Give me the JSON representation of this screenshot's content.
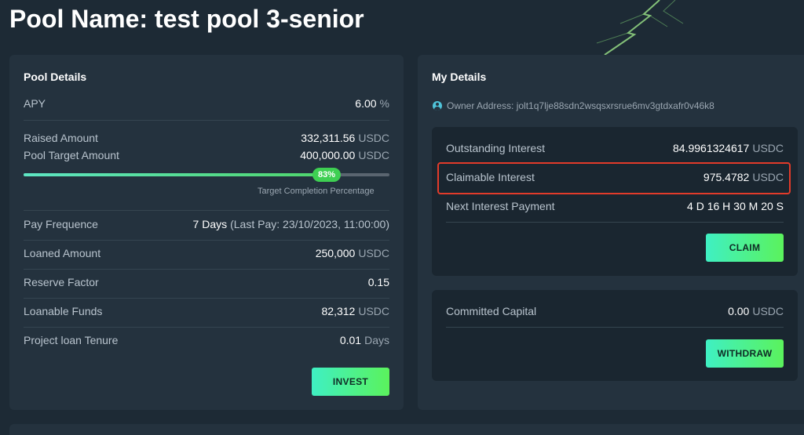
{
  "page": {
    "title": "Pool Name: test pool 3-senior"
  },
  "pool_details": {
    "title": "Pool Details",
    "apy": {
      "label": "APY",
      "value": "6.00",
      "unit": "%"
    },
    "raised": {
      "label": "Raised Amount",
      "value": "332,311.56",
      "unit": "USDC"
    },
    "target": {
      "label": "Pool Target Amount",
      "value": "400,000.00",
      "unit": "USDC"
    },
    "progress": {
      "percent": 83,
      "badge": "83%",
      "caption": "Target Completion Percentage"
    },
    "pay_frequence": {
      "label": "Pay Frequence",
      "value": "7 Days",
      "extra": "(Last Pay: 23/10/2023, 11:00:00)"
    },
    "loaned": {
      "label": "Loaned Amount",
      "value": "250,000",
      "unit": "USDC"
    },
    "reserve": {
      "label": "Reserve Factor",
      "value": "0.15"
    },
    "loanable": {
      "label": "Loanable Funds",
      "value": "82,312",
      "unit": "USDC"
    },
    "tenure": {
      "label": "Project loan Tenure",
      "value": "0.01",
      "unit": "Days"
    },
    "invest_label": "INVEST"
  },
  "my_details": {
    "title": "My Details",
    "owner_address": "Owner Address: jolt1q7lje88sdn2wsqsxrsrue6mv3gtdxafr0v46k8",
    "outstanding": {
      "label": "Outstanding Interest",
      "value": "84.9961324617",
      "unit": "USDC"
    },
    "claimable": {
      "label": "Claimable Interest",
      "value": "975.4782",
      "unit": "USDC"
    },
    "next_payment": {
      "label": "Next Interest Payment",
      "value": "4 D 16 H 30 M 20 S"
    },
    "claim_label": "CLAIM",
    "committed": {
      "label": "Committed Capital",
      "value": "0.00",
      "unit": "USDC"
    },
    "withdraw_label": "WITHDRAW"
  },
  "colors": {
    "accent_start": "#3ff0c3",
    "accent_end": "#5bf25c",
    "highlight": "#e23b2a",
    "background": "#1d2a35"
  }
}
